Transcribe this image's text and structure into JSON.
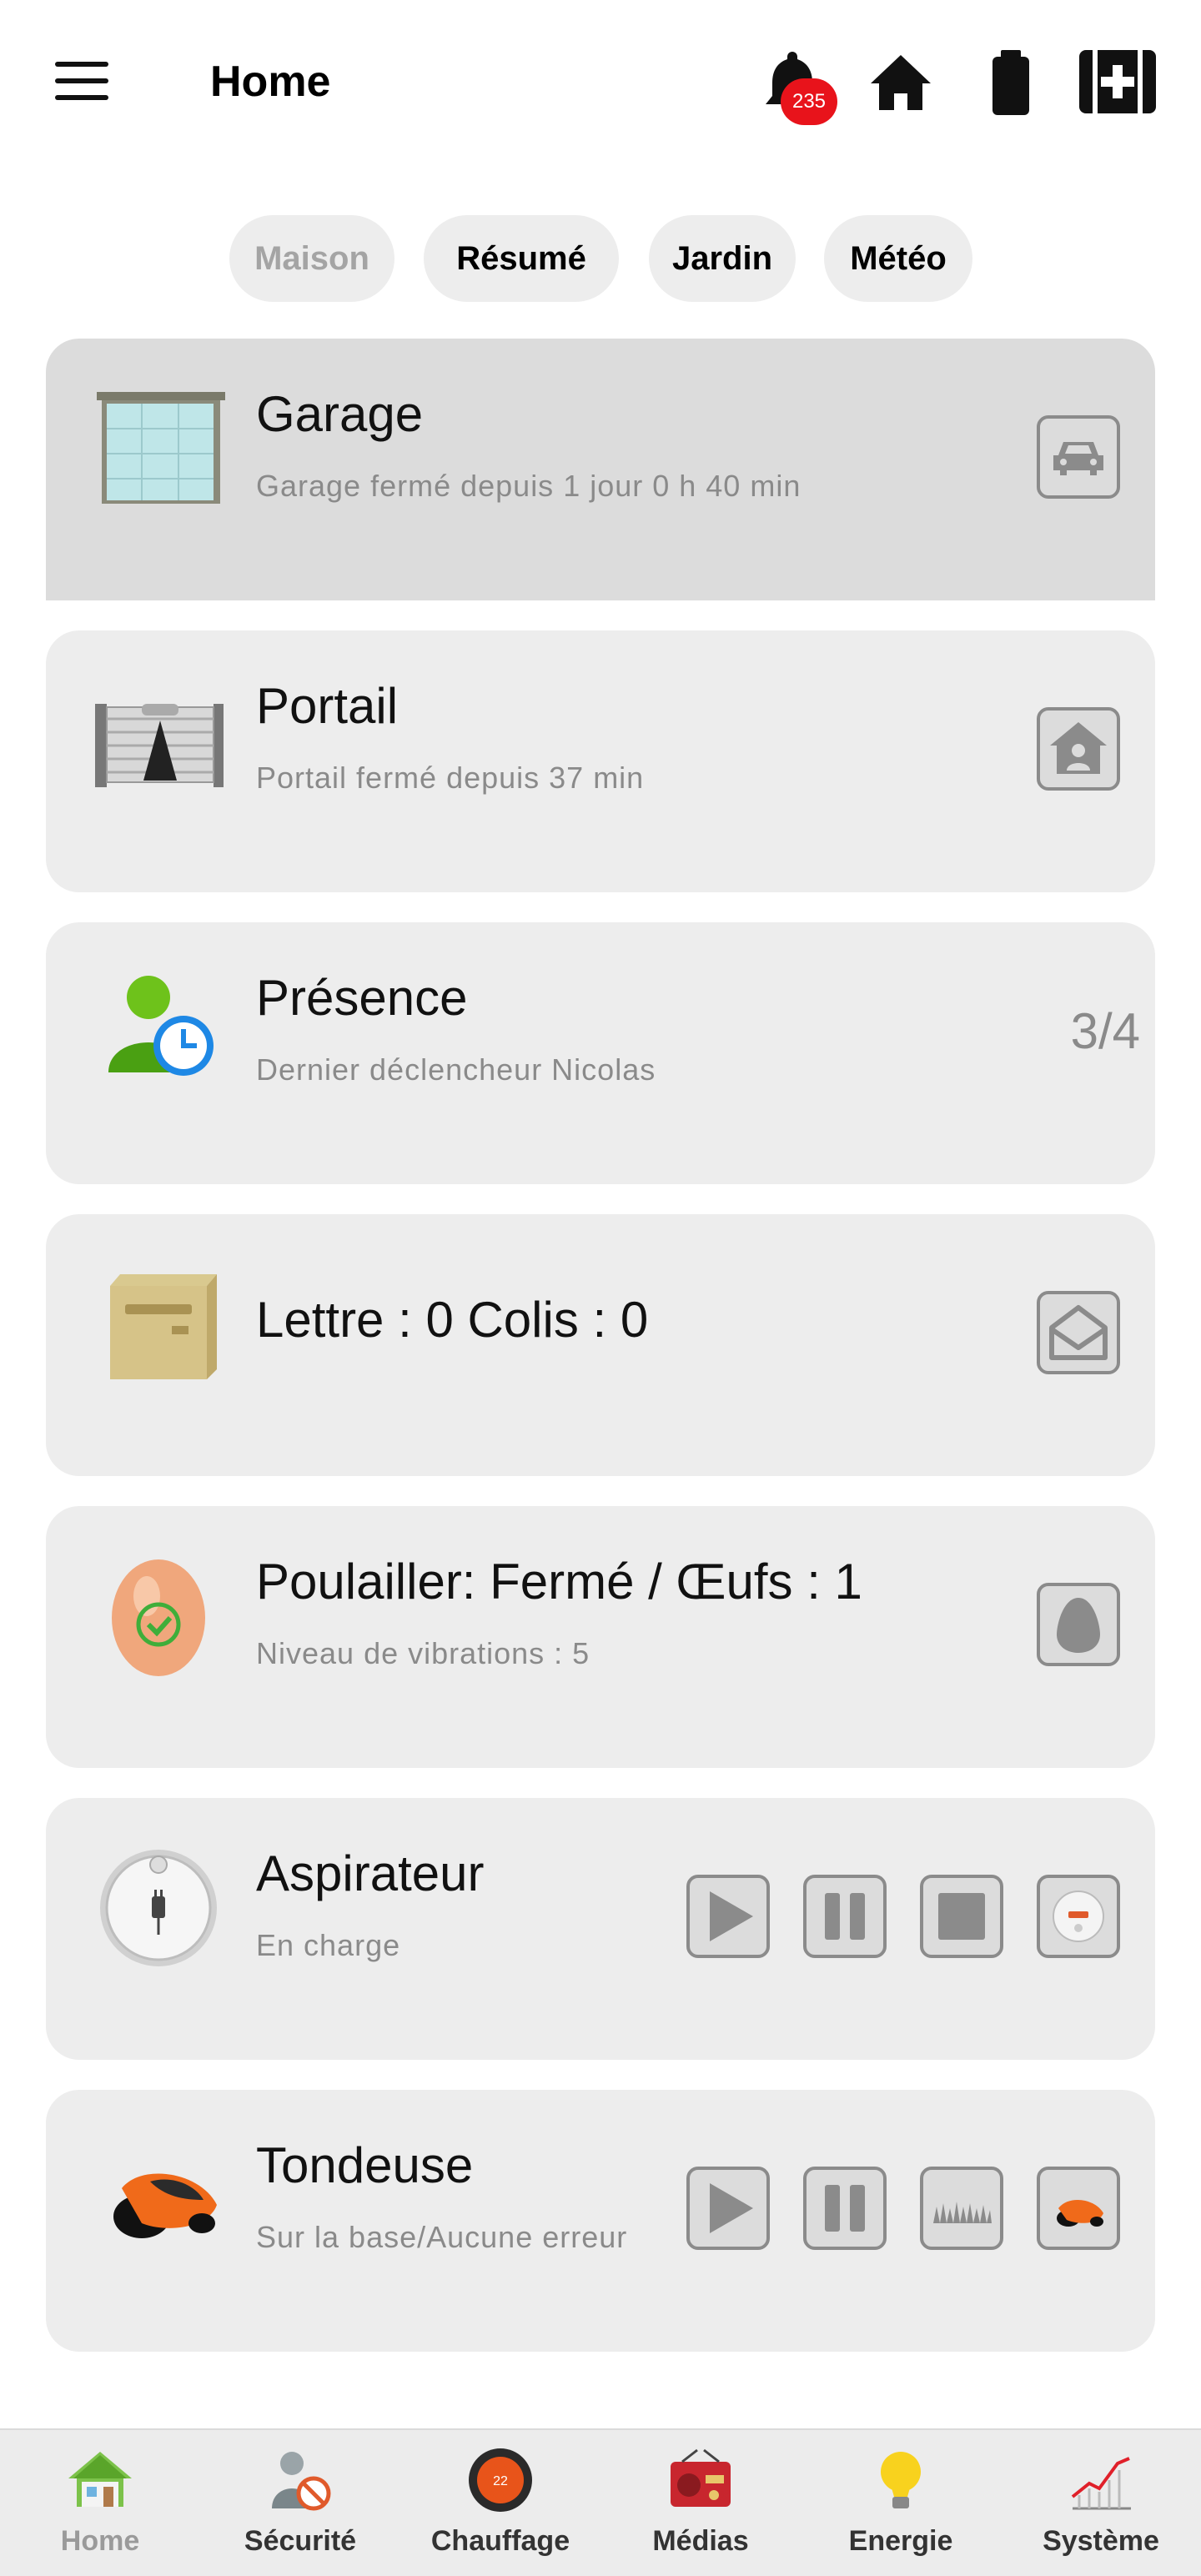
{
  "header": {
    "title": "Home",
    "notification_count": "235",
    "icons": [
      "menu-icon",
      "bell-icon",
      "home-icon",
      "battery-icon",
      "medical-cross-icon"
    ]
  },
  "tabs": [
    {
      "label": "Maison",
      "active": true
    },
    {
      "label": "Résumé",
      "active": false
    },
    {
      "label": "Jardin",
      "active": false
    },
    {
      "label": "Météo",
      "active": false
    }
  ],
  "cards": {
    "garage": {
      "title": "Garage",
      "subtitle": "Garage fermé depuis 1 jour 0 h 40 min",
      "action_icon": "car-icon"
    },
    "portail": {
      "title": "Portail",
      "subtitle": "Portail fermé depuis 37 min",
      "action_icon": "house-person-icon"
    },
    "presence": {
      "title": "Présence",
      "subtitle": "Dernier déclencheur Nicolas",
      "value": "3/4"
    },
    "mailbox": {
      "title": "Lettre :  0   Colis : 0",
      "action_icon": "open-envelope-icon"
    },
    "poulailler": {
      "title": "Poulailler: Fermé / Œufs : 1",
      "subtitle": "Niveau de vibrations : 5",
      "action_icon": "egg-icon"
    },
    "aspirateur": {
      "title": "Aspirateur",
      "subtitle": "En charge",
      "actions": [
        "play-icon",
        "pause-icon",
        "stop-icon",
        "robot-vacuum-icon"
      ]
    },
    "tondeuse": {
      "title": "Tondeuse",
      "subtitle": "Sur la base/Aucune erreur",
      "actions": [
        "play-icon",
        "pause-icon",
        "grass-icon",
        "robot-mower-icon"
      ]
    }
  },
  "bottom_nav": [
    {
      "label": "Home",
      "icon": "house-icon",
      "active": true
    },
    {
      "label": "Sécurité",
      "icon": "security-person-icon"
    },
    {
      "label": "Chauffage",
      "icon": "thermostat-icon",
      "badge": "22"
    },
    {
      "label": "Médias",
      "icon": "radio-icon"
    },
    {
      "label": "Energie",
      "icon": "light-bulb-icon"
    },
    {
      "label": "Système",
      "icon": "chart-icon"
    }
  ],
  "colors": {
    "accent_red": "#e8131b",
    "card_bg": "#ededed",
    "card_selected_bg": "#dcdcdc",
    "muted_text": "#8a8a8a"
  }
}
